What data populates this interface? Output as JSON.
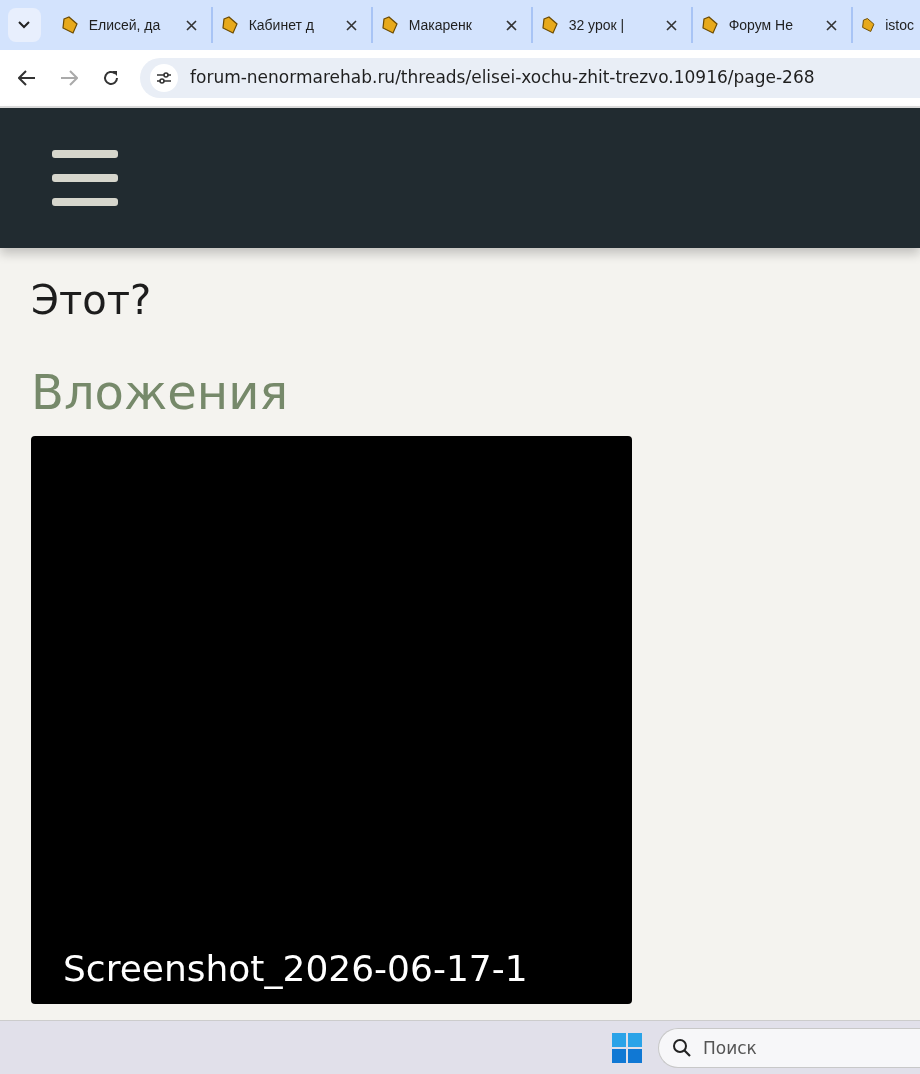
{
  "browser": {
    "tabs": [
      {
        "title": "Елисей, да",
        "closable": true
      },
      {
        "title": "Кабинет д",
        "closable": true
      },
      {
        "title": "Макаренк",
        "closable": true
      },
      {
        "title": "32 урок |",
        "closable": true
      },
      {
        "title": "Форум Не",
        "closable": true
      },
      {
        "title": "istoc",
        "closable": false
      }
    ],
    "address": "forum-nenormarehab.ru/threads/elisei-xochu-zhit-trezvo.10916/page-268",
    "forward_disabled": true
  },
  "post": {
    "text": "Этот?",
    "attachments_heading": "Вложения",
    "attachments": [
      {
        "caption": "Screenshot_2026-06-17-1"
      }
    ]
  },
  "taskbar": {
    "search_placeholder": "Поиск"
  }
}
